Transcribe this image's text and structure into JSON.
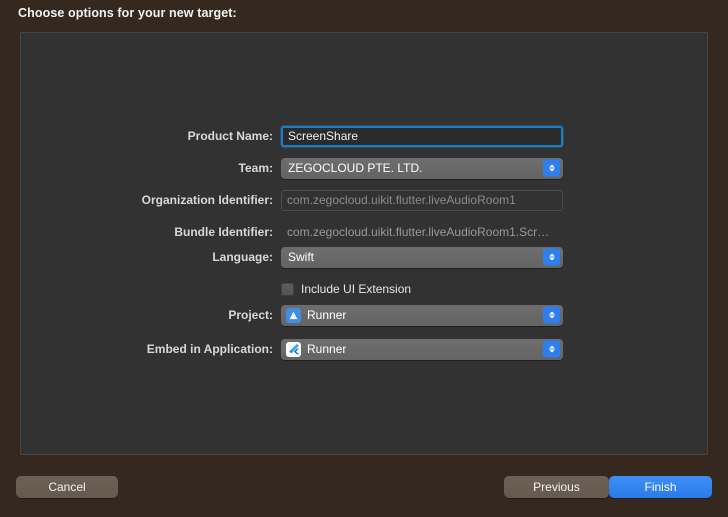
{
  "sheet": {
    "title": "Choose options for your new target:"
  },
  "form": {
    "fields": [
      {
        "label": "Product Name:",
        "value": "ScreenShare",
        "type": "textfield",
        "state": "focused"
      },
      {
        "label": "Team:",
        "value": "ZEGOCLOUD PTE. LTD.",
        "type": "popup",
        "state": "enabled"
      },
      {
        "label": "Organization Identifier:",
        "value": "com.zegocloud.uikit.flutter.liveAudioRoom1",
        "type": "textfield",
        "state": "disabled"
      },
      {
        "label": "Bundle Identifier:",
        "value": "com.zegocloud.uikit.flutter.liveAudioRoom1.Scr…",
        "type": "statictext",
        "state": "disabled"
      },
      {
        "label": "Language:",
        "value": "Swift",
        "type": "popup",
        "state": "enabled"
      },
      {
        "label": "",
        "value": "Include UI Extension",
        "type": "checkbox",
        "state": "unchecked"
      },
      {
        "label": "Project:",
        "value": "Runner",
        "type": "popup",
        "state": "enabled",
        "icon": "xcode-project-icon"
      },
      {
        "label": "Embed in Application:",
        "value": "Runner",
        "type": "popup",
        "state": "enabled",
        "icon": "flutter-app-icon"
      }
    ]
  },
  "buttons": {
    "cancel": "Cancel",
    "previous": "Previous",
    "finish": "Finish"
  },
  "colors": {
    "sheet_background": "#35291f",
    "panel_background": "#323232",
    "accent_blue": "#2d7ff0",
    "focus_ring": "#1d7ec4",
    "default_button": "#2a7be8"
  }
}
